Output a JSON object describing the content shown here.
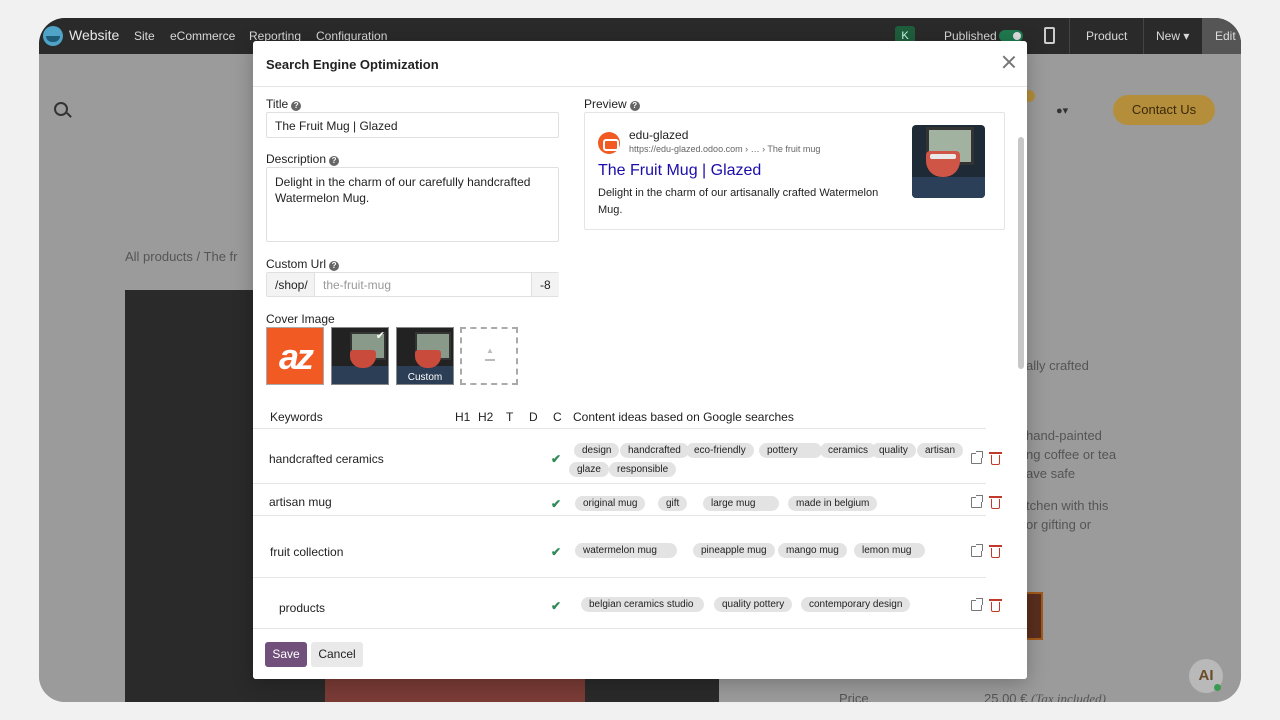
{
  "topbar": {
    "brand": "Website",
    "menu": [
      "Site",
      "eCommerce",
      "Reporting",
      "Configuration"
    ],
    "account_badge": "K",
    "published_label": "Published",
    "product_label": "Product",
    "new_label": "New ▾",
    "edit_label": "Edit"
  },
  "background_page": {
    "contact_label": "Contact Us",
    "user_menu": "▾",
    "breadcrumb": "All products  /  The fr",
    "text_lines": [
      "ally crafted",
      "hand-painted",
      "ng coffee or tea",
      "ave safe",
      "tchen with this",
      "or gifting or"
    ],
    "price_label": "Price",
    "price_value": "25.00 €",
    "tax_note": "(Tax included)",
    "ai_label": "AI"
  },
  "modal": {
    "title": "Search Engine Optimization",
    "title_label": "Title",
    "title_value": "The Fruit Mug | Glazed",
    "description_label": "Description",
    "description_value": "Delight in the charm of our carefully handcrafted Watermelon Mug.",
    "custom_url_label": "Custom Url",
    "url_prefix": "/shop/",
    "url_placeholder": "the-fruit-mug",
    "url_suffix": "-8",
    "cover_image_label": "Cover Image",
    "cover_logo_text": "az",
    "cover_custom_label": "Custom",
    "preview_label": "Preview",
    "preview": {
      "site_name": "edu-glazed",
      "url": "https://edu-glazed.odoo.com › … › The fruit mug",
      "title": "The Fruit Mug | Glazed",
      "description": "Delight in the charm of our artisanally crafted Watermelon Mug."
    },
    "keywords_header": {
      "keywords": "Keywords",
      "h1": "H1",
      "h2": "H2",
      "t": "T",
      "d": "D",
      "c": "C",
      "content_ideas": "Content ideas based on Google searches"
    },
    "keywords": [
      {
        "name": "handcrafted ceramics",
        "tags": [
          "design",
          "handcrafted",
          "eco-friendly",
          "pottery",
          "ceramics",
          "quality",
          "artisan",
          "glaze",
          "responsible"
        ]
      },
      {
        "name": "artisan mug",
        "tags": [
          "original mug",
          "gift",
          "large mug",
          "made in belgium"
        ]
      },
      {
        "name": "fruit collection",
        "tags": [
          "watermelon mug",
          "pineapple mug",
          "mango mug",
          "lemon mug"
        ]
      },
      {
        "name": "products",
        "tags": [
          "belgian ceramics studio",
          "quality pottery",
          "contemporary design"
        ]
      }
    ],
    "save_label": "Save",
    "cancel_label": "Cancel"
  }
}
